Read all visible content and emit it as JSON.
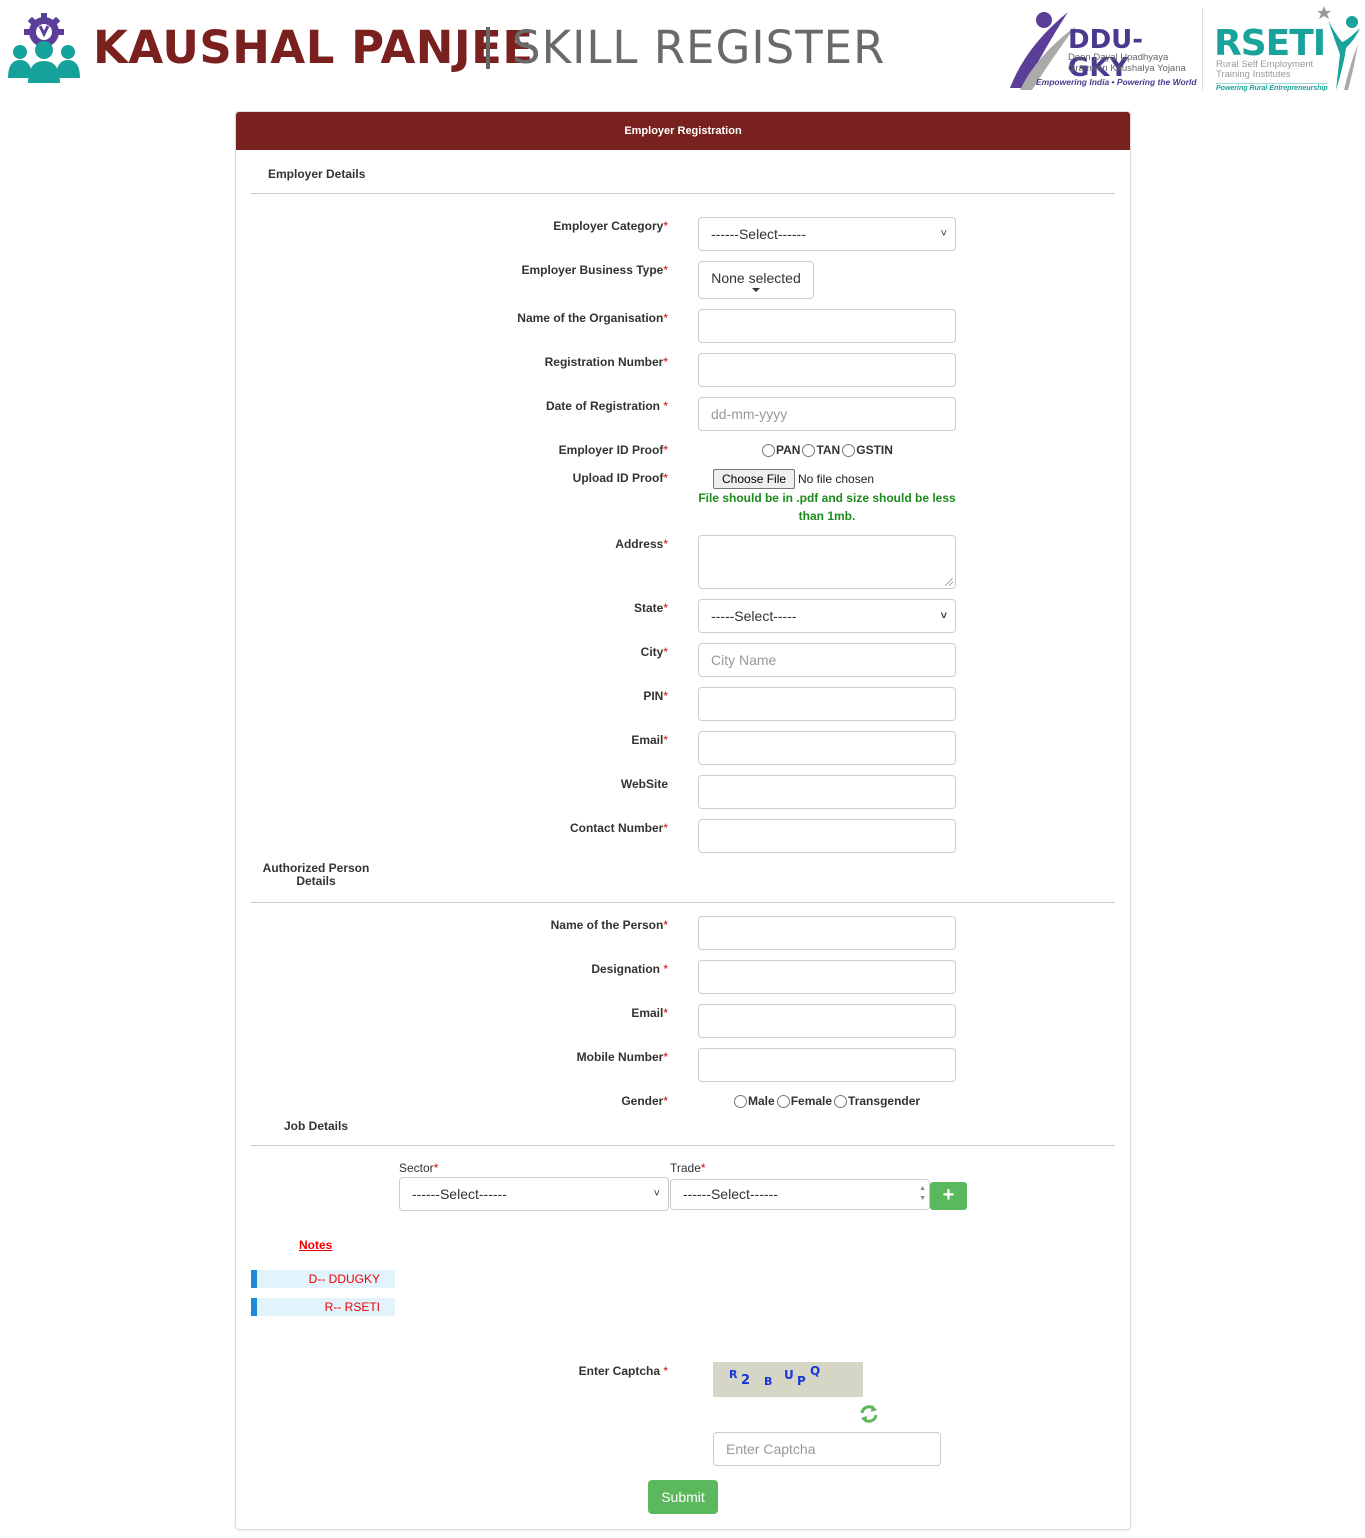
{
  "header": {
    "brand_main": "KAUSHAL PANJEE",
    "brand_sub": "SKILL REGISTER",
    "ddugky": {
      "title": "DDU-GKY",
      "line1": "Deen Dayal Upadhyaya",
      "line2": "Grameen Kaushalya Yojana",
      "tagline": "Empowering India • Powering the World"
    },
    "rseti": {
      "title": "RSETI",
      "line1": "Rural Self Employment",
      "line2": "Training Institutes",
      "tagline": "Powering Rural Entrepreneurship"
    }
  },
  "form": {
    "title": "Employer Registration",
    "sections": {
      "employer": "Employer Details",
      "authorized_line1": "Authorized Person",
      "authorized_line2": "Details",
      "job": "Job Details"
    },
    "required_mark": "*",
    "employer": {
      "category": {
        "label": "Employer Category",
        "value": "------Select------"
      },
      "business_type": {
        "label": "Employer Business Type",
        "value": "None selected"
      },
      "org_name": {
        "label": "Name of the Organisation",
        "value": ""
      },
      "reg_number": {
        "label": "Registration Number",
        "value": ""
      },
      "reg_date": {
        "label": "Date of Registration ",
        "placeholder": "dd-mm-yyyy"
      },
      "id_proof": {
        "label": "Employer ID Proof",
        "options": [
          "PAN",
          "TAN",
          "GSTIN"
        ]
      },
      "upload": {
        "label": "Upload ID Proof",
        "button": "Choose File",
        "status": "No file chosen",
        "hint": "File should be in .pdf and size should be less than 1mb."
      },
      "address": {
        "label": "Address",
        "value": ""
      },
      "state": {
        "label": "State",
        "value": "-----Select-----"
      },
      "city": {
        "label": "City",
        "placeholder": "City Name"
      },
      "pin": {
        "label": "PIN",
        "value": ""
      },
      "email": {
        "label": "Email",
        "value": ""
      },
      "website": {
        "label": "WebSite",
        "value": ""
      },
      "contact": {
        "label": "Contact Number",
        "value": ""
      }
    },
    "authorized": {
      "name": {
        "label": "Name of the Person",
        "value": ""
      },
      "designation": {
        "label": "Designation ",
        "value": ""
      },
      "email": {
        "label": "Email",
        "value": ""
      },
      "mobile": {
        "label": "Mobile Number",
        "value": ""
      },
      "gender": {
        "label": "Gender",
        "options": [
          "Male",
          "Female",
          "Transgender"
        ]
      }
    },
    "job": {
      "sector": {
        "label": "Sector",
        "value": "------Select------"
      },
      "trade": {
        "label": "Trade",
        "value": "------Select------"
      },
      "add_button": "+"
    },
    "notes": {
      "title": "Notes",
      "items": [
        "D-- DDUGKY",
        "R-- RSETI"
      ]
    },
    "captcha": {
      "label": "Enter Captcha ",
      "chars": [
        "R",
        "2",
        "B",
        "U",
        "P",
        "Q"
      ],
      "placeholder": "Enter Captcha"
    },
    "submit": "Submit"
  },
  "colors": {
    "brand": "#7a2120",
    "panel_header": "#78211e",
    "success": "#5cb85c",
    "hint": "#1d8a1d",
    "notes_accent": "#1c8ad8",
    "required": "#dd0000"
  }
}
